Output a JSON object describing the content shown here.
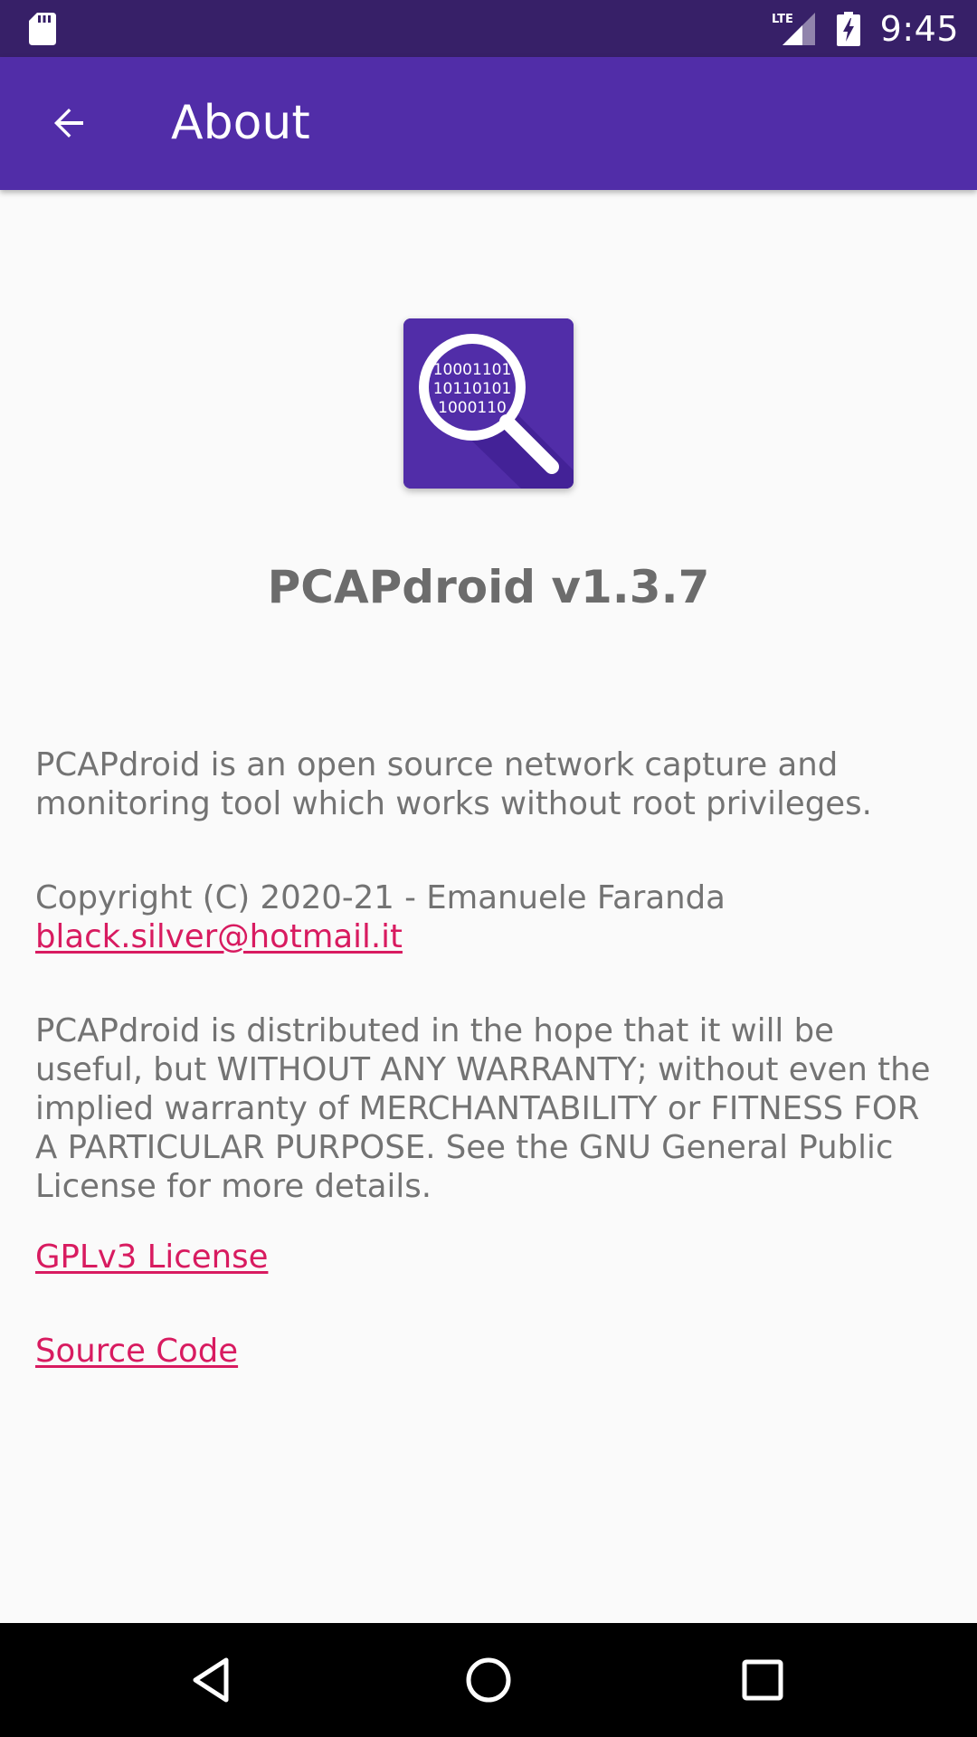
{
  "status_bar": {
    "time": "9:45",
    "network_label": "LTE",
    "icons": [
      "sd-card-icon",
      "lte-signal-icon",
      "battery-charging-icon"
    ]
  },
  "app_bar": {
    "title": "About",
    "back_icon": "arrow-back-icon",
    "background": "#512da8"
  },
  "about": {
    "app_name": "PCAPdroid v1.3.7",
    "description": "PCAPdroid is an open source network capture and monitoring tool which works without root privileges.",
    "copyright": "Copyright (C) 2020-21 - Emanuele Faranda",
    "email": "black.silver@hotmail.it",
    "warranty": "PCAPdroid is distributed in the hope that it will be useful, but WITHOUT ANY WARRANTY; without even the implied warranty of MERCHANTABILITY or FITNESS FOR A PARTICULAR PURPOSE. See the GNU General Public License for more details.",
    "license_link": "GPLv3 License",
    "source_link": "Source Code",
    "logo": {
      "icon": "magnifier-binary-icon",
      "binary_lines": [
        "10001101",
        "10110101",
        "1000110"
      ]
    },
    "link_color": "#d81b60"
  },
  "nav_bar": {
    "buttons": [
      "back-triangle-icon",
      "home-circle-icon",
      "recents-square-icon"
    ]
  }
}
